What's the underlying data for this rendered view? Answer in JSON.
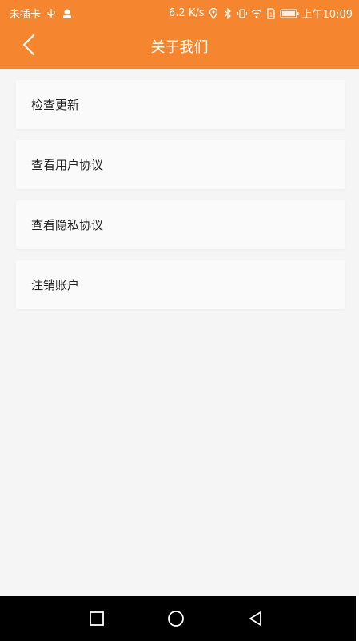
{
  "status_bar": {
    "carrier": "未插卡",
    "speed": "6.2 K/s",
    "time": "上午10:09"
  },
  "header": {
    "title": "关于我们"
  },
  "menu": {
    "items": [
      {
        "label": "检查更新"
      },
      {
        "label": "查看用户协议"
      },
      {
        "label": "查看隐私协议"
      },
      {
        "label": "注销账户"
      }
    ]
  },
  "colors": {
    "accent": "#f5852f",
    "background": "#f5f5f5",
    "item_background": "#fafafa"
  },
  "icons": {
    "back": "chevron-left-icon",
    "nav_recents": "square-icon",
    "nav_home": "circle-icon",
    "nav_back": "triangle-back-icon"
  }
}
